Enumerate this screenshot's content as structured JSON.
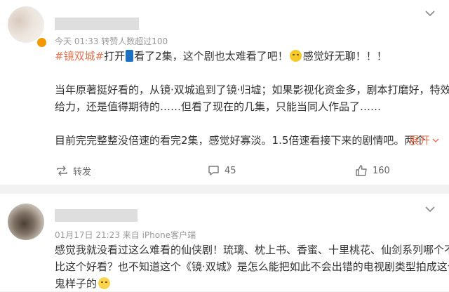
{
  "post1": {
    "meta": "今天 01:33 转赞人数超过100",
    "lines": [
      {
        "hashtag": "#镜双城#",
        "pre": "打开",
        "post": "看了2集，这个剧也太难看了吧！",
        "tail": "感觉好无聊！！！"
      },
      {
        "text": "当年原著挺好看的，从镜·双城追到了镜·归墟；如果影视化资金多，剧本打磨好，特效"
      },
      {
        "text": "给力，还是值得期待的……但看了现在的几集，只能当同人作品了……"
      },
      {
        "text": "目前完完整整没倍速的看完2集，感觉好寡淡。1.5倍速看接下来的剧情吧。两个",
        "expand": "展开"
      }
    ],
    "actions": {
      "repost": "转发",
      "comment": "45",
      "like": "160"
    },
    "colors": {
      "hashtag": "#eb7350",
      "badge": "#f39800"
    }
  },
  "post2": {
    "meta": "01月17日 21:23 来自 iPhone客户端",
    "lines": [
      {
        "text": "感觉我就没看过这么难看的仙侠剧！琉璃、枕上书、香蜜、十里桃花、仙剑系列哪个不"
      },
      {
        "text": "比这个好看？也不知道这个《镜·双城》是怎么能把如此不会出错的电视剧类型拍成这个"
      },
      {
        "text": "鬼样子的"
      }
    ]
  },
  "icons": [
    "link-icon",
    "emoji-sleepy-icon",
    "emoji-sweat-icon",
    "chevron-down-icon",
    "repost-icon",
    "comment-icon",
    "like-icon"
  ]
}
